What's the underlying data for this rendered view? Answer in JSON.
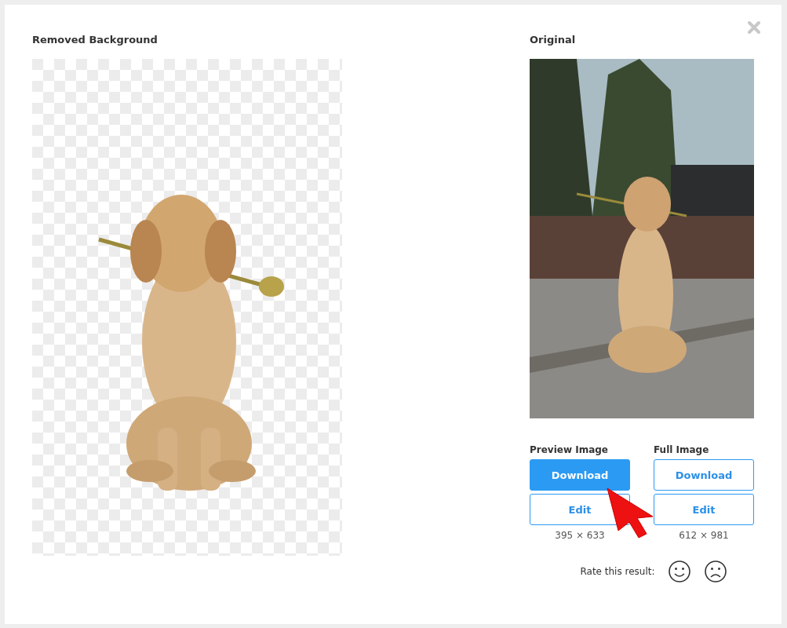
{
  "removed": {
    "title": "Removed Background",
    "picture": {
      "transparent": true
    }
  },
  "original": {
    "title": "Original",
    "picture": {
      "transparent": false
    }
  },
  "downloads": [
    {
      "title": "Preview Image",
      "buttons": [
        {
          "label": "Download",
          "primary": true
        },
        {
          "label": "Edit",
          "primary": false
        }
      ],
      "size": "395 × 633"
    },
    {
      "title": "Full Image",
      "buttons": [
        {
          "label": "Download",
          "primary": false
        },
        {
          "label": "Edit",
          "primary": false
        }
      ],
      "size": "612 × 981"
    }
  ],
  "rating": {
    "label": "Rate this result:"
  }
}
